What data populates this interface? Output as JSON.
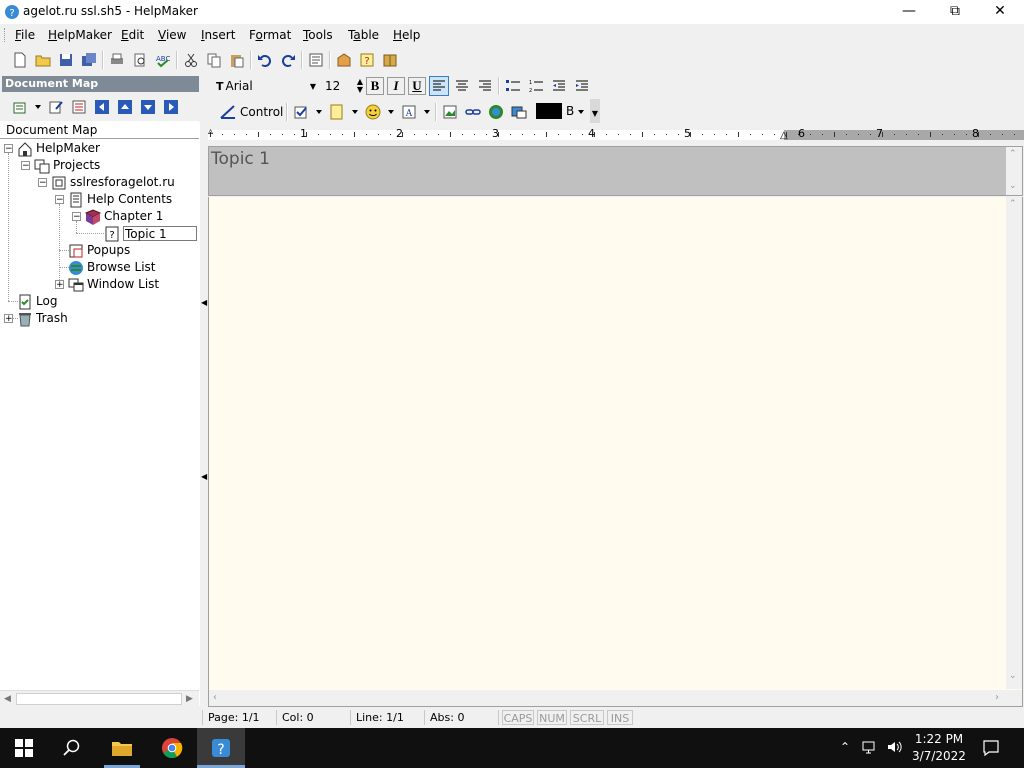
{
  "window": {
    "title": "agelot.ru ssl.sh5 - HelpMaker"
  },
  "menu": [
    "File",
    "HelpMaker",
    "Edit",
    "View",
    "Insert",
    "Format",
    "Tools",
    "Table",
    "Help"
  ],
  "menu_underline": [
    "F",
    "H",
    "E",
    "V",
    "I",
    "o",
    "T",
    "a",
    "H"
  ],
  "docmap": {
    "header": "Document Map",
    "label": "Document Map",
    "tree": {
      "root": "HelpMaker",
      "projects": "Projects",
      "project": "sslresforagelot.ru",
      "help_contents": "Help Contents",
      "chapter": "Chapter 1",
      "topic_edit_value": "Topic 1",
      "popups": "Popups",
      "browse_list": "Browse List",
      "window_list": "Window List",
      "log": "Log",
      "trash": "Trash"
    }
  },
  "format_bar": {
    "font": "Arial",
    "size": "12",
    "bold": "B",
    "italic": "I",
    "underline": "U",
    "control": "Control",
    "color_label": "B"
  },
  "ruler": {
    "marks": [
      "1",
      "2",
      "3",
      "4",
      "5",
      "6",
      "7",
      "8"
    ]
  },
  "editor": {
    "topic_title": "Topic 1"
  },
  "status": {
    "page": "Page: 1/1",
    "col": "Col: 0",
    "line": "Line: 1/1",
    "abs": "Abs: 0",
    "caps": "CAPS",
    "num": "NUM",
    "scrl": "SCRL",
    "ins": "INS"
  },
  "taskbar": {
    "time": "1:22 PM",
    "date": "3/7/2022"
  },
  "colors": {
    "docmap_header": "#7e8a96",
    "editor_bg": "#fffbef",
    "topic_bar": "#c0c0c0",
    "taskbar": "#101010"
  }
}
